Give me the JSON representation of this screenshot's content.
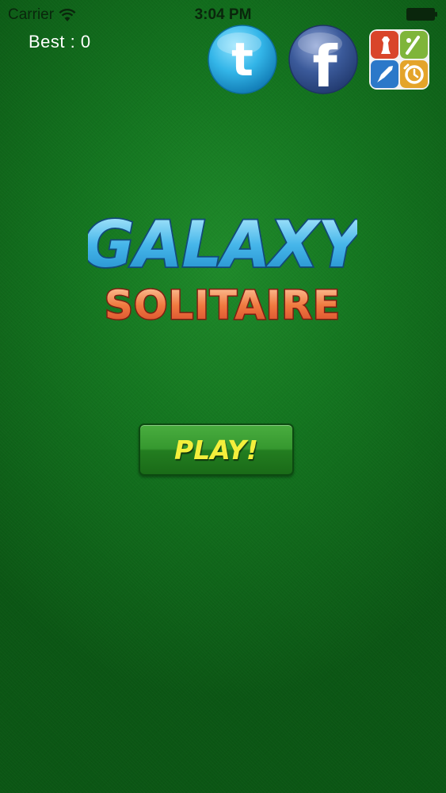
{
  "status_bar": {
    "carrier": "Carrier",
    "time": "3:04 PM",
    "wifi_icon": "wifi-icon",
    "battery_icon": "battery-icon"
  },
  "score": {
    "best_label": "Best : 0"
  },
  "social": {
    "twitter_letter": "t",
    "facebook_letter": "f",
    "twitter_icon": "twitter-icon",
    "facebook_icon": "facebook-icon",
    "gamecenter_icon": "game-center-icon"
  },
  "logo": {
    "line1": "GALAXY",
    "line2": "SOLITAIRE"
  },
  "menu": {
    "play_label": "PLAY!"
  },
  "colors": {
    "felt_green": "#147620",
    "play_text": "#f4ef3c",
    "galaxy_blue": "#46b6ea",
    "solitaire_orange": "#f07a40",
    "twitter_blue": "#33b5e8",
    "facebook_blue": "#3b5a9a"
  }
}
